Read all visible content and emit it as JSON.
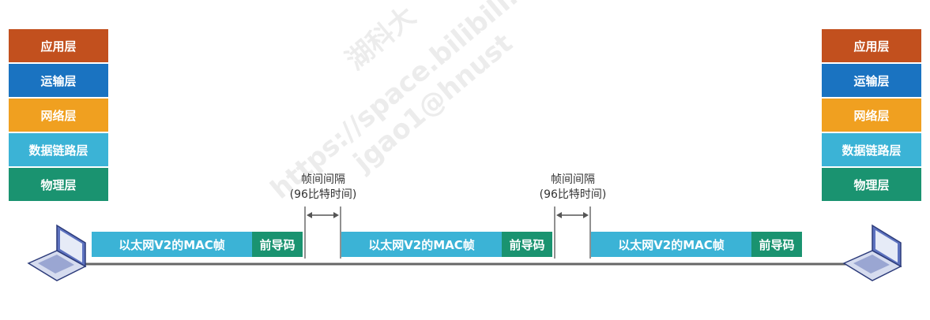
{
  "layers": [
    {
      "label": "应用层",
      "color": "#c2501e"
    },
    {
      "label": "运输层",
      "color": "#1a73c1"
    },
    {
      "label": "网络层",
      "color": "#f0a020"
    },
    {
      "label": "数据链路层",
      "color": "#3bb3d6"
    },
    {
      "label": "物理层",
      "color": "#1a9370"
    }
  ],
  "frames": [
    {
      "mac": "以太网V2的MAC帧",
      "preamble": "前导码"
    },
    {
      "mac": "以太网V2的MAC帧",
      "preamble": "前导码"
    },
    {
      "mac": "以太网V2的MAC帧",
      "preamble": "前导码"
    }
  ],
  "gaps": [
    {
      "line1": "帧间间隔",
      "line2": "(96比特时间)"
    },
    {
      "line1": "帧间间隔",
      "line2": "(96比特时间)"
    }
  ],
  "watermark": {
    "line1": "湖科大",
    "line2": "https://space.bilibili.com/",
    "line3": "jgao1@hnust"
  },
  "icons": {
    "left": "laptop-icon",
    "right": "laptop-icon"
  }
}
